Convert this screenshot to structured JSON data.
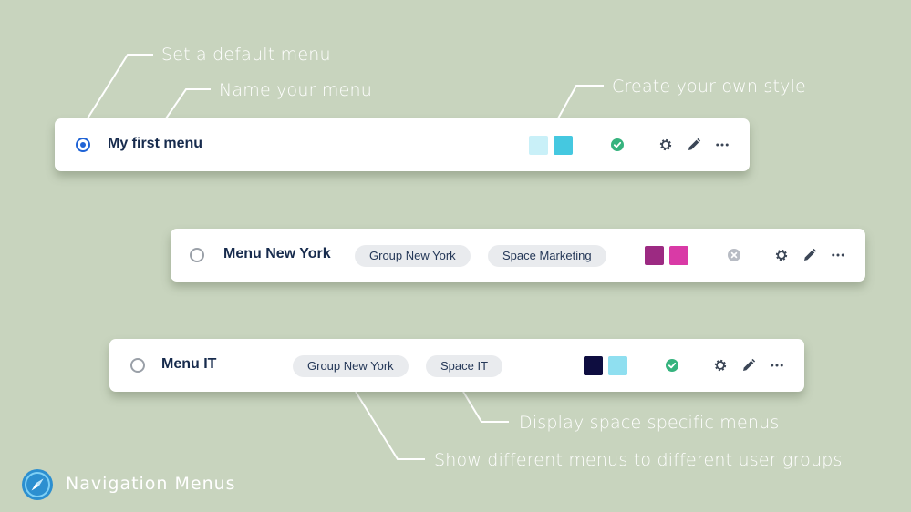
{
  "annotations": {
    "default_menu": "Set a default menu",
    "name_menu": "Name your menu",
    "own_style": "Create your own style",
    "space_specific": "Display space specific menus",
    "user_groups": "Show different menus to different user groups"
  },
  "menus": [
    {
      "name": "My first menu",
      "selected": true,
      "groups": [],
      "colors": [
        "#c9f0f8",
        "#45c8e0"
      ],
      "status": "enabled"
    },
    {
      "name": "Menu New York",
      "selected": false,
      "groups": [
        "Group New York",
        "Space Marketing"
      ],
      "colors": [
        "#9c2a82",
        "#d93aa6"
      ],
      "status": "disabled"
    },
    {
      "name": "Menu IT",
      "selected": false,
      "groups": [
        "Group New York",
        "Space IT"
      ],
      "colors": [
        "#0e0d40",
        "#8fdff0"
      ],
      "status": "enabled"
    }
  ],
  "icons": {
    "settings": "gear-icon",
    "edit": "pencil-icon",
    "more": "more-dots-icon",
    "enabled": "check-circle-icon",
    "disabled": "x-circle-icon",
    "brand": "compass-icon"
  },
  "brand": {
    "name": "Navigation Menus",
    "color": "#2c8fd0"
  }
}
